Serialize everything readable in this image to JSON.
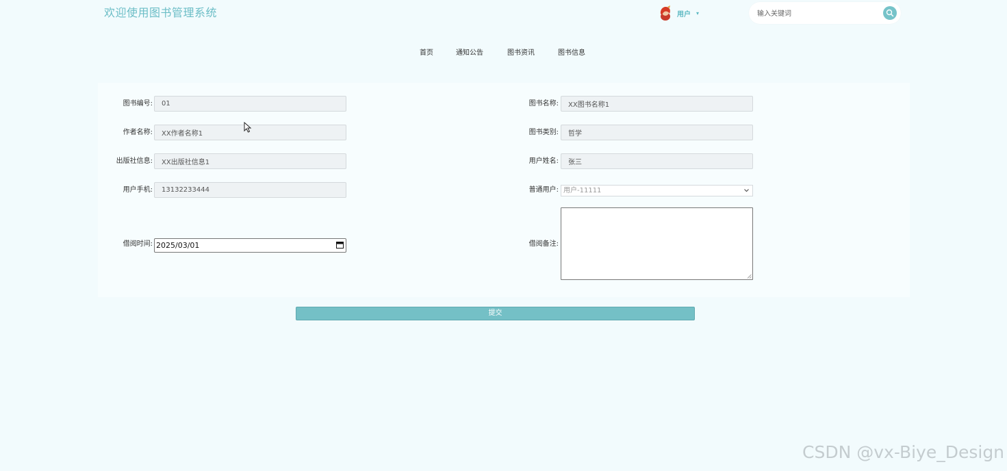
{
  "header": {
    "site_title": "欢迎使用图书管理系统",
    "user_name": "用户",
    "user_caret": "▾",
    "search_placeholder": "输入关键词"
  },
  "nav": {
    "items": [
      {
        "label": "首页"
      },
      {
        "label": "通知公告"
      },
      {
        "label": "图书资讯"
      },
      {
        "label": "图书信息"
      }
    ]
  },
  "form": {
    "book_no": {
      "label": "图书编号:",
      "value": "01"
    },
    "book_name": {
      "label": "图书名称:",
      "value": "XX图书名称1"
    },
    "author": {
      "label": "作者名称:",
      "value": "XX作者名称1"
    },
    "book_category": {
      "label": "图书类别:",
      "value": "哲学"
    },
    "publisher": {
      "label": "出版社信息:",
      "value": "XX出版社信息1"
    },
    "user_real_name": {
      "label": "用户姓名:",
      "value": "张三"
    },
    "user_phone": {
      "label": "用户手机:",
      "value": "13132233444"
    },
    "normal_user": {
      "label": "普通用户:",
      "value": "用户-11111"
    },
    "borrow_time": {
      "label": "借阅时间:",
      "value": "2025/03/01"
    },
    "borrow_note": {
      "label": "借阅备注:",
      "value": ""
    },
    "submit_label": "提交"
  },
  "watermark": "CSDN @vx-Biye_Design"
}
